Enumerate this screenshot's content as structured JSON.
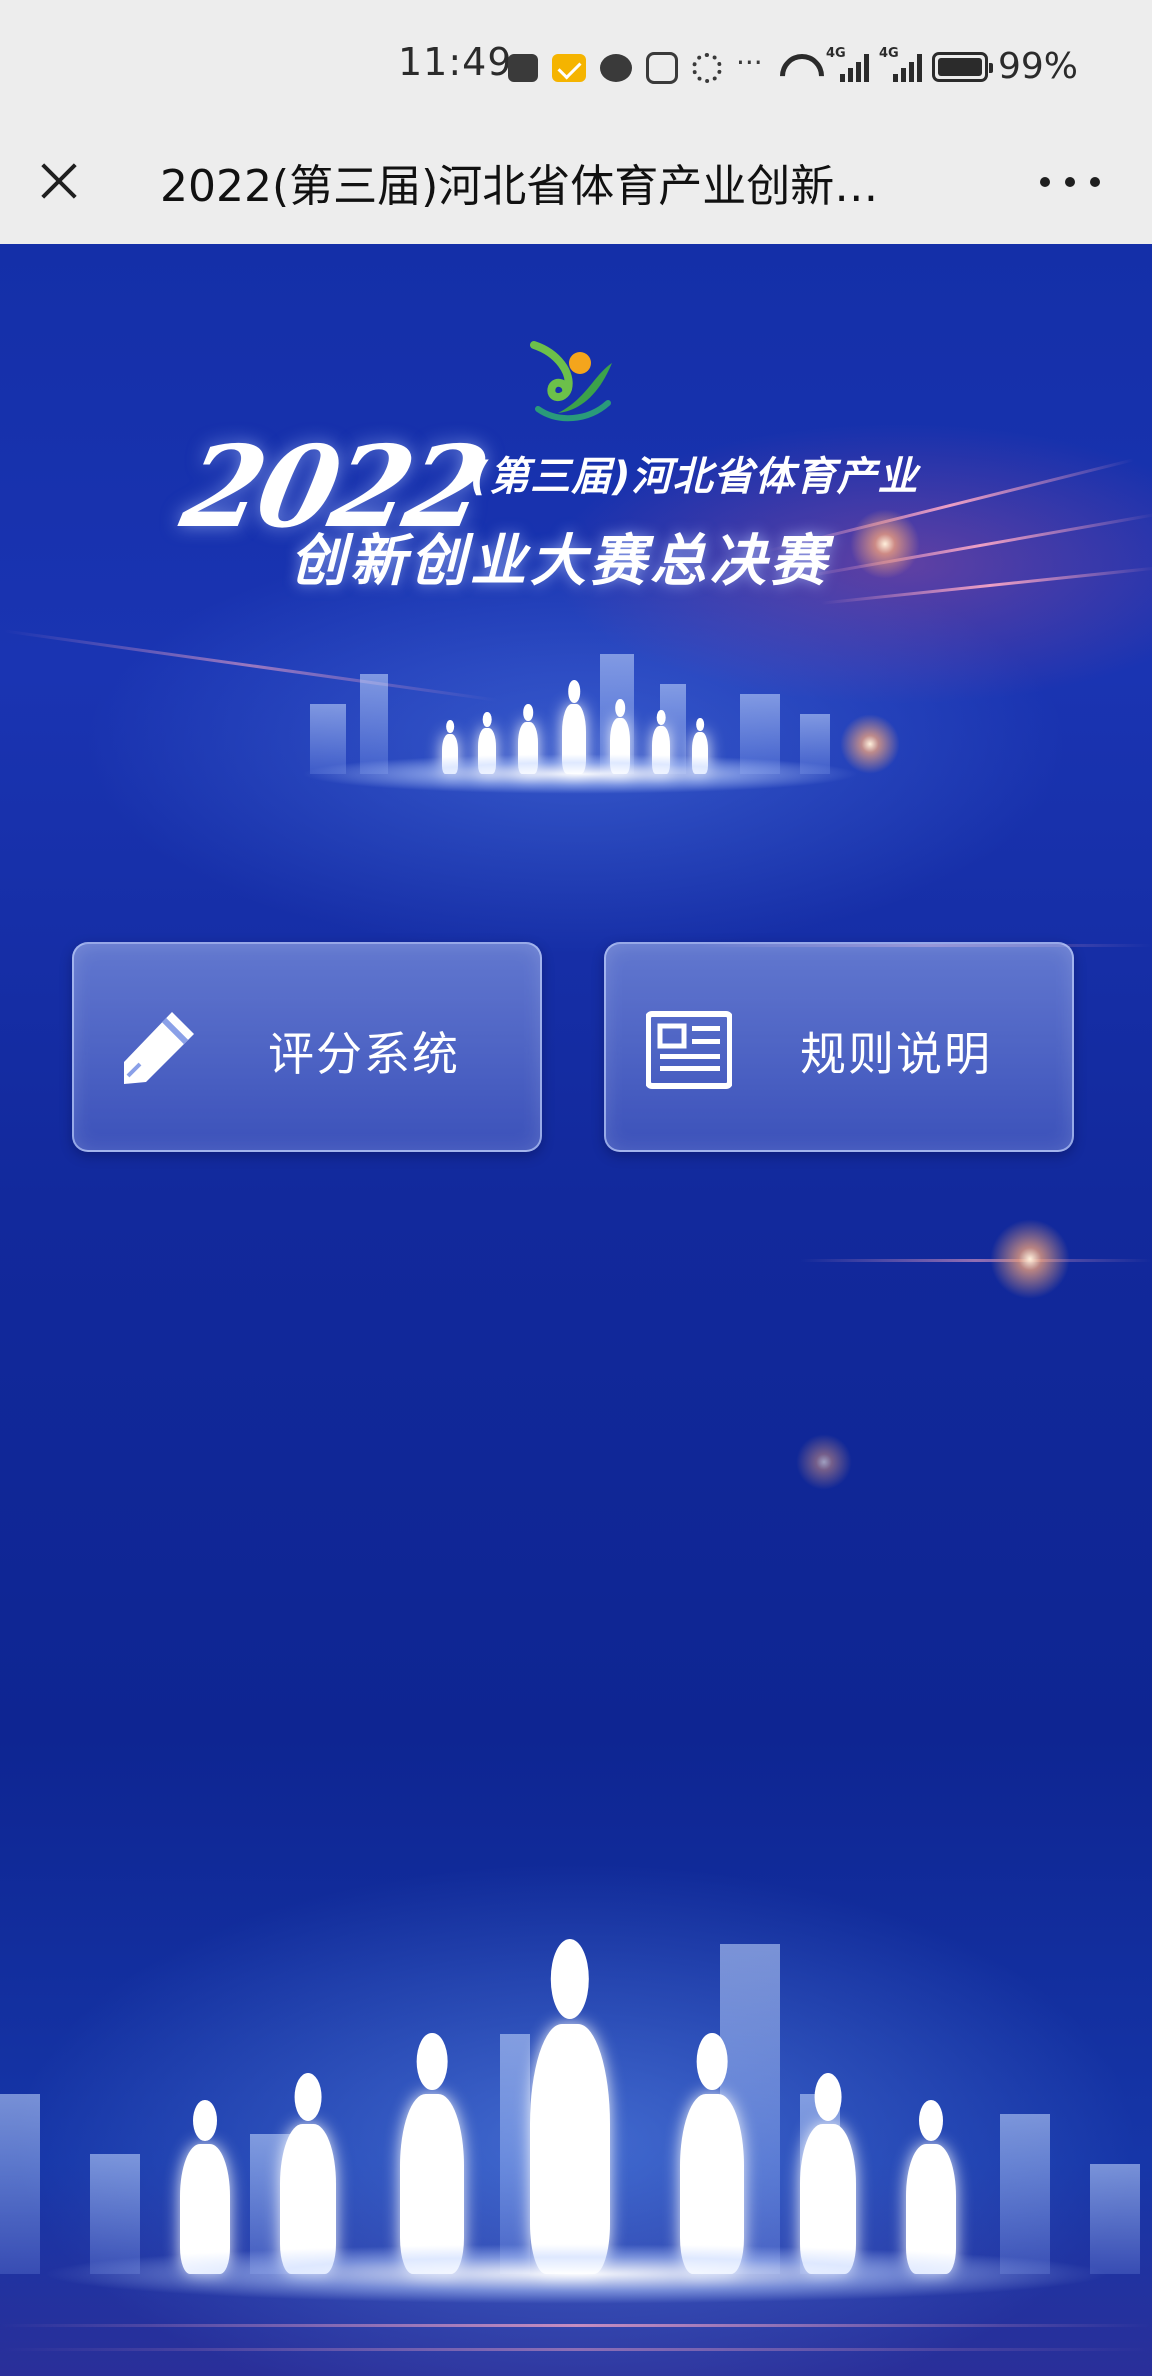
{
  "status_bar": {
    "time": "11:49",
    "network_1": "4G",
    "network_2": "4G",
    "battery_percent": "99%"
  },
  "title_bar": {
    "title": "2022(第三届)河北省体育产业创新…"
  },
  "banner": {
    "year": "2022",
    "line1": "(第三届)河北省体育产业",
    "line2": "创新创业大赛总决赛"
  },
  "menu": {
    "scoring_label": "评分系统",
    "rules_label": "规则说明"
  },
  "icons": {
    "close": "close-icon",
    "more": "more-icon",
    "scoring": "pencil-icon",
    "rules": "document-icon"
  },
  "colors": {
    "background_blue": "#142fa8",
    "button_glass": "#8aa0e8",
    "text_white": "#ffffff",
    "bar_gray": "#ededed"
  }
}
